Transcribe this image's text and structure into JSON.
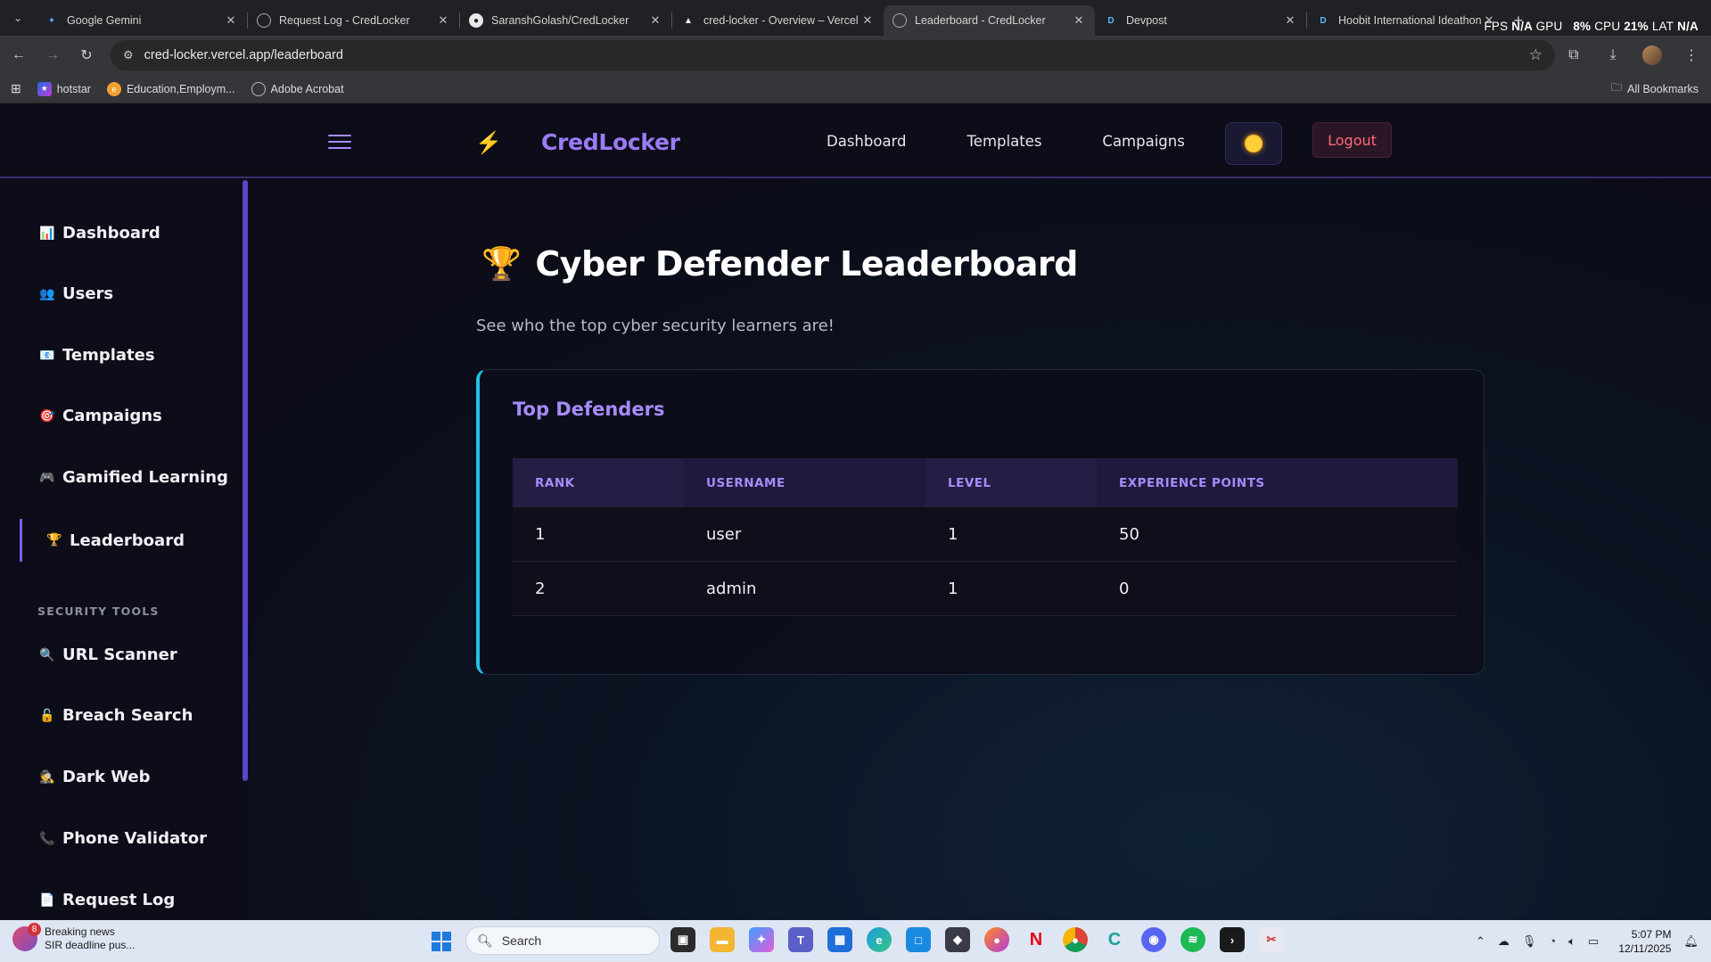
{
  "browser": {
    "tabs": [
      {
        "title": "Google Gemini",
        "icon": "gemini-icon",
        "active": false
      },
      {
        "title": "Request Log - CredLocker",
        "icon": "globe-icon",
        "active": false
      },
      {
        "title": "SaranshGolash/CredLocker",
        "icon": "github-icon",
        "active": false
      },
      {
        "title": "cred-locker - Overview – Vercel",
        "icon": "vercel-icon",
        "active": false
      },
      {
        "title": "Leaderboard - CredLocker",
        "icon": "globe-icon",
        "active": true
      },
      {
        "title": "Devpost",
        "icon": "devpost-icon",
        "active": false
      },
      {
        "title": "Hoobit International Ideathon:",
        "icon": "devpost-icon",
        "active": false
      }
    ],
    "perf": {
      "fps_label": "FPS",
      "fps": "N/A",
      "gpu_label": "GPU",
      "gpu": "8%",
      "cpu_label": "CPU",
      "cpu": "21%",
      "lat_label": "LAT",
      "lat": "N/A"
    },
    "url": "cred-locker.vercel.app/leaderboard",
    "bookmarks": [
      {
        "label": "hotstar",
        "icon": "hotstar-icon"
      },
      {
        "label": "Education,Employm...",
        "icon": "education-icon"
      },
      {
        "label": "Adobe Acrobat",
        "icon": "acrobat-icon"
      }
    ],
    "all_bookmarks": "All Bookmarks"
  },
  "app": {
    "brand": "CredLocker",
    "topnav": [
      "Dashboard",
      "Templates",
      "Campaigns"
    ],
    "logout": "Logout",
    "sidebar": {
      "items": [
        {
          "label": "Dashboard",
          "icon": "📊"
        },
        {
          "label": "Users",
          "icon": "👥"
        },
        {
          "label": "Templates",
          "icon": "📧"
        },
        {
          "label": "Campaigns",
          "icon": "🎯"
        },
        {
          "label": "Gamified Learning",
          "icon": "🎮"
        },
        {
          "label": "Leaderboard",
          "icon": "🏆"
        }
      ],
      "section_label": "SECURITY TOOLS",
      "tools": [
        {
          "label": "URL Scanner",
          "icon": "🔍"
        },
        {
          "label": "Breach Search",
          "icon": "🔓"
        },
        {
          "label": "Dark Web",
          "icon": "🕵"
        },
        {
          "label": "Phone Validator",
          "icon": "📞"
        },
        {
          "label": "Request Log",
          "icon": "📄"
        }
      ]
    },
    "page": {
      "title_icon": "🏆",
      "title": "Cyber Defender Leaderboard",
      "subtitle": "See who the top cyber security learners are!"
    },
    "card": {
      "title": "Top Defenders",
      "columns": [
        "RANK",
        "USERNAME",
        "LEVEL",
        "EXPERIENCE POINTS"
      ],
      "rows": [
        [
          "1",
          "user",
          "1",
          "50"
        ],
        [
          "2",
          "admin",
          "1",
          "0"
        ]
      ]
    },
    "accent": "#a78bfa",
    "card_border_accent": "#22c1e6"
  },
  "taskbar": {
    "news_badge": "8",
    "news_title": "Breaking news",
    "news_sub": "SIR deadline pus...",
    "search_placeholder": "Search",
    "time": "5:07 PM",
    "date": "12/11/2025"
  }
}
